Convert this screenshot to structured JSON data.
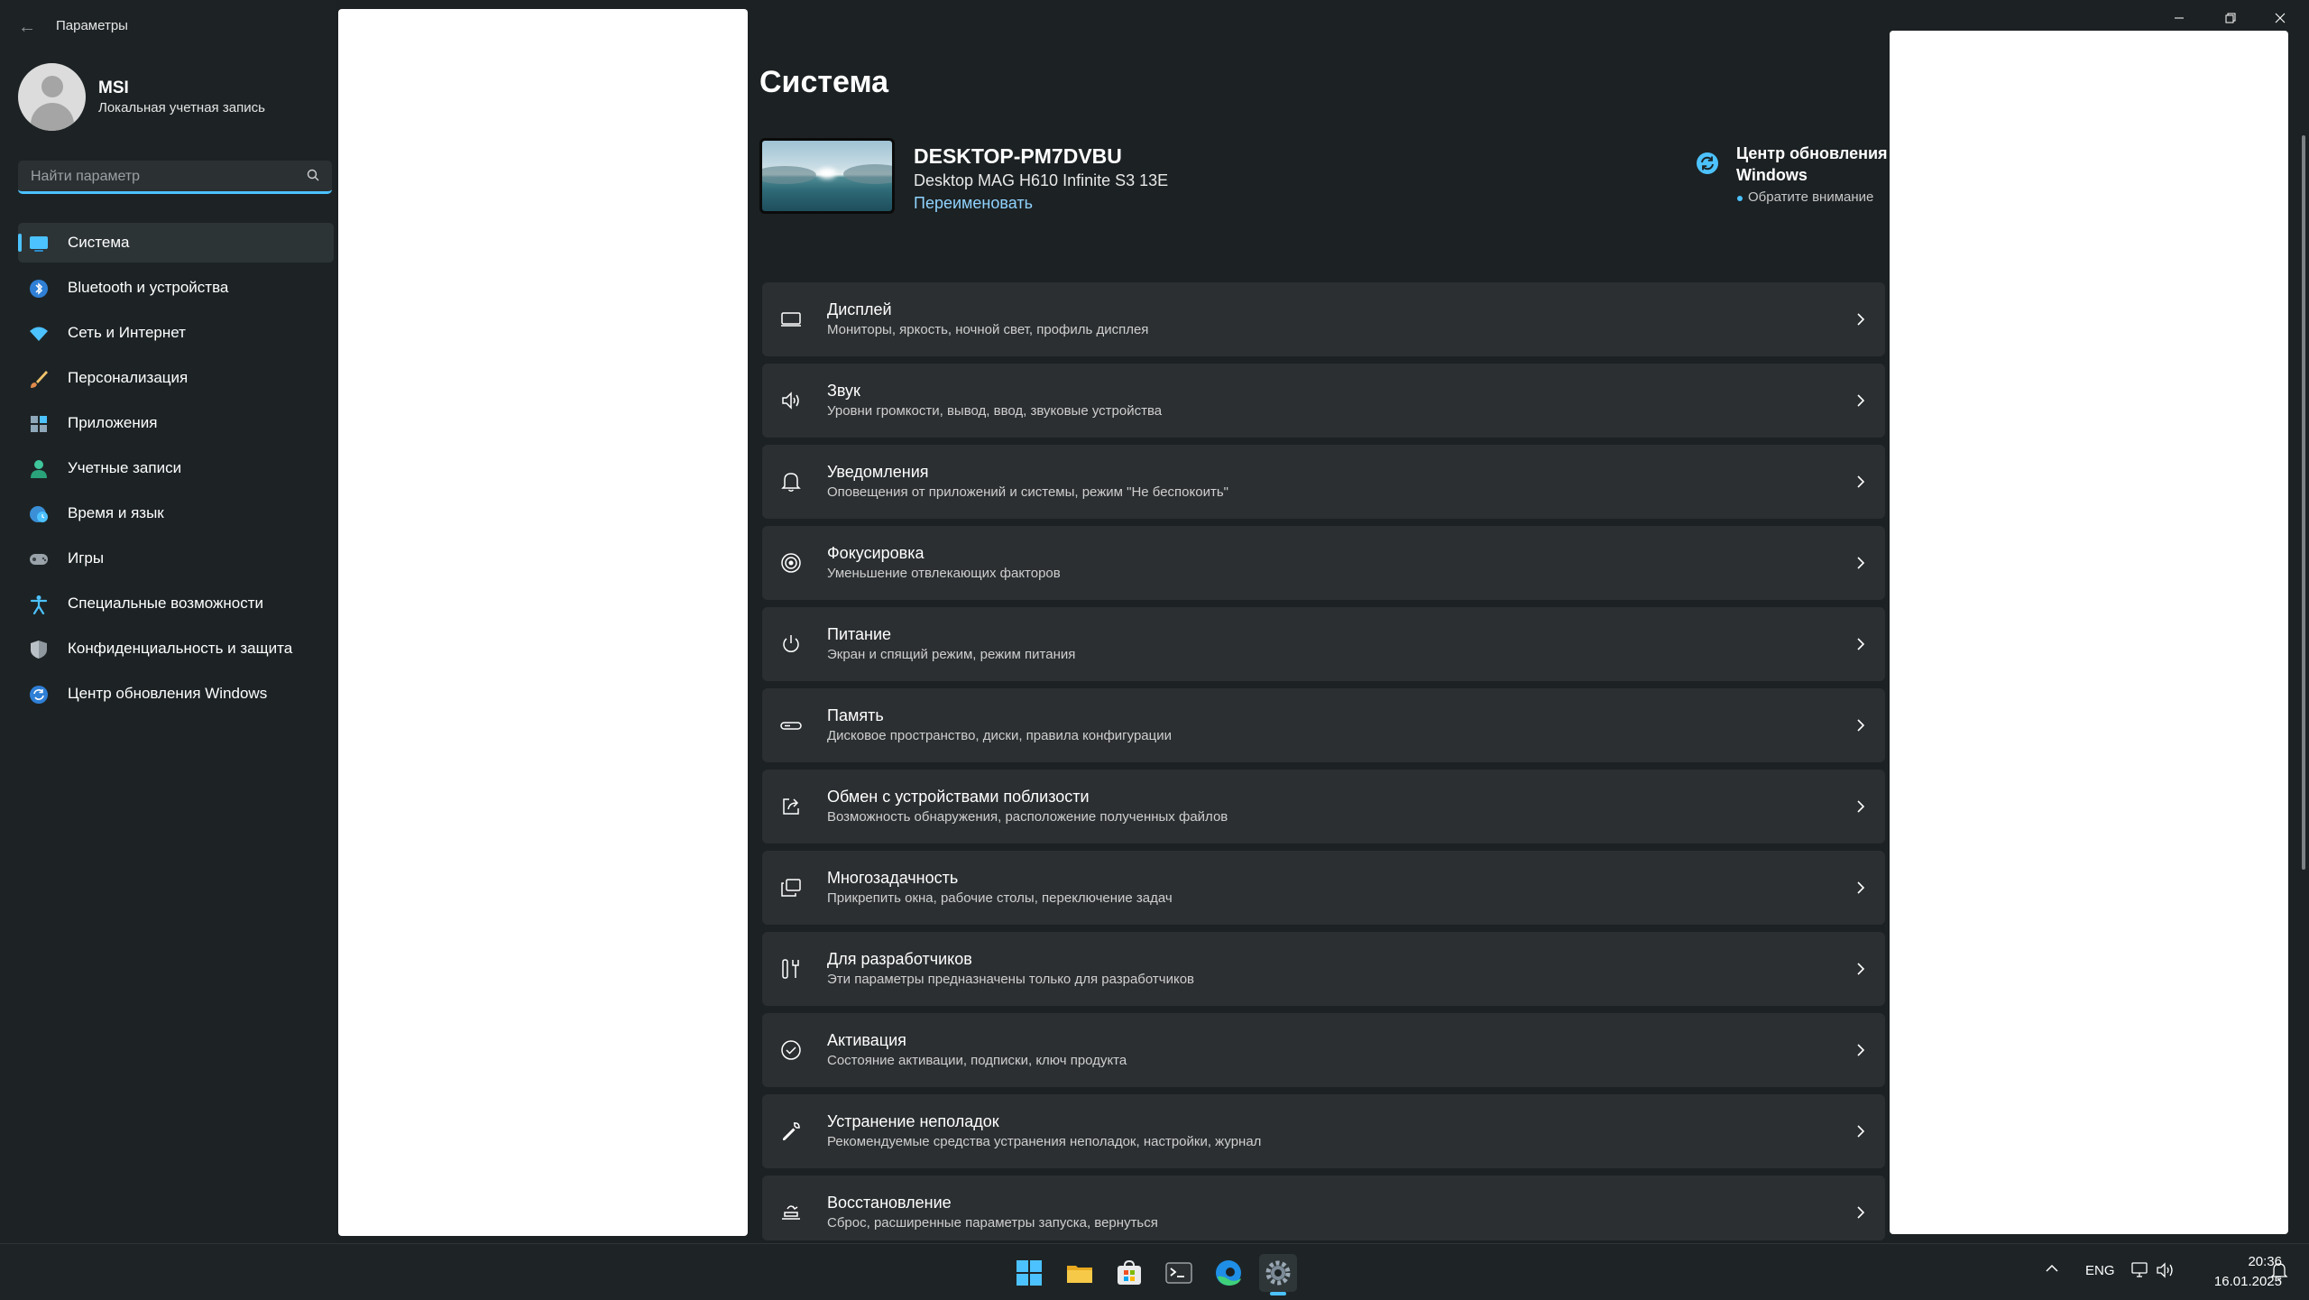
{
  "app": {
    "back_label": "←",
    "title": "Параметры"
  },
  "user": {
    "name": "MSI",
    "account_type": "Локальная учетная запись"
  },
  "search": {
    "placeholder": "Найти параметр"
  },
  "sidebar": {
    "items": [
      {
        "label": "Система",
        "icon": "system-icon",
        "selected": true
      },
      {
        "label": "Bluetooth и устройства",
        "icon": "bluetooth-icon"
      },
      {
        "label": "Сеть и Интернет",
        "icon": "wifi-icon"
      },
      {
        "label": "Персонализация",
        "icon": "brush-icon"
      },
      {
        "label": "Приложения",
        "icon": "apps-icon"
      },
      {
        "label": "Учетные записи",
        "icon": "person-icon"
      },
      {
        "label": "Время и язык",
        "icon": "globe-clock-icon"
      },
      {
        "label": "Игры",
        "icon": "gamepad-icon"
      },
      {
        "label": "Специальные возможности",
        "icon": "accessibility-icon"
      },
      {
        "label": "Конфиденциальность и защита",
        "icon": "shield-icon"
      },
      {
        "label": "Центр обновления Windows",
        "icon": "update-icon"
      }
    ]
  },
  "main": {
    "title": "Система",
    "device": {
      "name": "DESKTOP-PM7DVBU",
      "model": "Desktop MAG H610 Infinite S3 13E",
      "rename_label": "Переименовать"
    },
    "update": {
      "title": "Центр обновления Windows",
      "status": "Обратите внимание"
    },
    "cards": [
      {
        "title": "Дисплей",
        "subtitle": "Мониторы, яркость, ночной свет, профиль дисплея",
        "icon": "display-icon"
      },
      {
        "title": "Звук",
        "subtitle": "Уровни громкости, вывод, ввод, звуковые устройства",
        "icon": "speaker-icon"
      },
      {
        "title": "Уведомления",
        "subtitle": "Оповещения от приложений и системы, режим \"Не беспокоить\"",
        "icon": "bell-icon"
      },
      {
        "title": "Фокусировка",
        "subtitle": "Уменьшение отвлекающих факторов",
        "icon": "focus-icon"
      },
      {
        "title": "Питание",
        "subtitle": "Экран и спящий режим, режим питания",
        "icon": "power-icon"
      },
      {
        "title": "Память",
        "subtitle": "Дисковое пространство, диски, правила конфигурации",
        "icon": "storage-icon"
      },
      {
        "title": "Обмен с устройствами поблизости",
        "subtitle": "Возможность обнаружения, расположение полученных файлов",
        "icon": "share-icon"
      },
      {
        "title": "Многозадачность",
        "subtitle": "Прикрепить окна, рабочие столы, переключение задач",
        "icon": "multitask-icon"
      },
      {
        "title": "Для разработчиков",
        "subtitle": "Эти параметры предназначены только для разработчиков",
        "icon": "developer-icon"
      },
      {
        "title": "Активация",
        "subtitle": "Состояние активации, подписки, ключ продукта",
        "icon": "activation-icon"
      },
      {
        "title": "Устранение неполадок",
        "subtitle": "Рекомендуемые средства устранения неполадок, настройки, журнал",
        "icon": "wrench-icon"
      },
      {
        "title": "Восстановление",
        "subtitle": "Сброс, расширенные параметры запуска, вернуться",
        "icon": "recovery-icon"
      }
    ]
  },
  "taskbar": {
    "apps": [
      "start-icon",
      "file-explorer-icon",
      "store-icon",
      "terminal-icon",
      "edge-icon",
      "settings-icon"
    ],
    "language": "ENG",
    "time": "20:36",
    "date": "16.01.2025"
  },
  "colors": {
    "accent": "#4cc2ff",
    "background": "#1c2123",
    "card": "#2b2f31"
  }
}
